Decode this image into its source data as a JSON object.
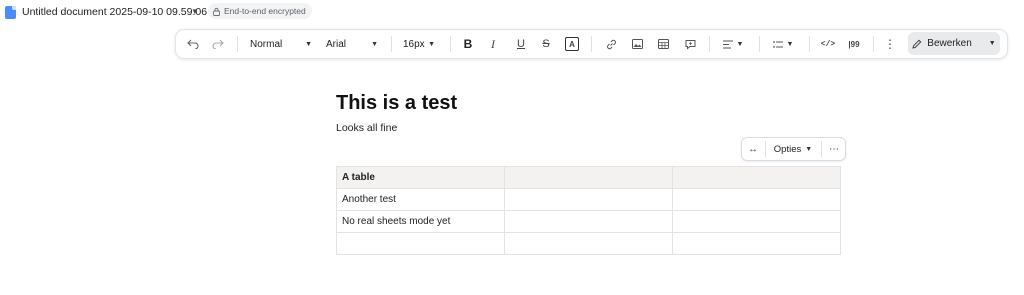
{
  "window": {
    "doc_title": "Untitled document 2025-09-10 09.59.06",
    "encryption_badge": "End-to-end encrypted"
  },
  "toolbar": {
    "undo_icon": "undo-icon",
    "redo_icon": "redo-icon",
    "paragraph_style": "Normal",
    "font_family": "Arial",
    "font_size": "16px",
    "bold_glyph": "B",
    "italic_glyph": "I",
    "underline_glyph": "U",
    "strike_glyph": "S",
    "text_color_glyph": "A",
    "code_glyph": "</>",
    "quote_glyph": "|99",
    "more_glyph": "⋮",
    "edit_mode_label": "Bewerken"
  },
  "document": {
    "heading": "This is a test",
    "paragraph": "Looks all fine",
    "table_toolbar": {
      "resize_glyph": "↔",
      "options_label": "Opties",
      "more_glyph": "⋯"
    },
    "table": {
      "header": [
        "A table",
        "",
        ""
      ],
      "rows": [
        [
          "Another test",
          "",
          ""
        ],
        [
          "No real sheets mode yet",
          "",
          ""
        ],
        [
          "",
          "",
          ""
        ]
      ]
    }
  },
  "colors": {
    "accent_blue": "#4a8df6",
    "header_cell_bg": "#f3f2f0",
    "edit_button_bg": "#e9eaec"
  }
}
